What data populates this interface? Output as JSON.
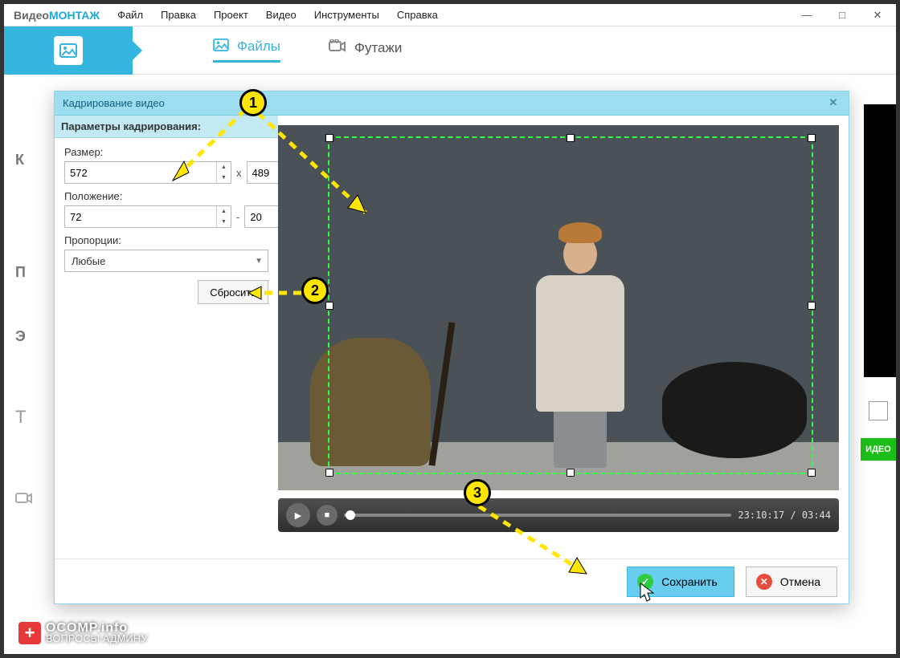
{
  "brand": {
    "p1": "Видео",
    "p2": "МОНТАЖ"
  },
  "menu": [
    "Файл",
    "Правка",
    "Проект",
    "Видео",
    "Инструменты",
    "Справка"
  ],
  "tabs": {
    "files": "Файлы",
    "footage": "Футажи"
  },
  "sidebar_hints": [
    "К",
    "П",
    "Э",
    "T"
  ],
  "right_badge": "ИДЕО",
  "dialog": {
    "title": "Кадрирование видео",
    "panel_header": "Параметры кадрирования:",
    "labels": {
      "size": "Размер:",
      "position": "Положение:",
      "aspect": "Пропорции:"
    },
    "size": {
      "w": "572",
      "h": "489"
    },
    "position": {
      "x": "72",
      "y": "20"
    },
    "separator_size": "x",
    "separator_pos": "-",
    "aspect_value": "Любые",
    "reset": "Сбросить",
    "time": "23:10:17 / 03:44",
    "save": "Сохранить",
    "cancel": "Отмена"
  },
  "steps": [
    "1",
    "2",
    "3"
  ],
  "watermark": {
    "site": "OCOMP.info",
    "sub": "ВОПРОСЫ АДМИНУ"
  }
}
